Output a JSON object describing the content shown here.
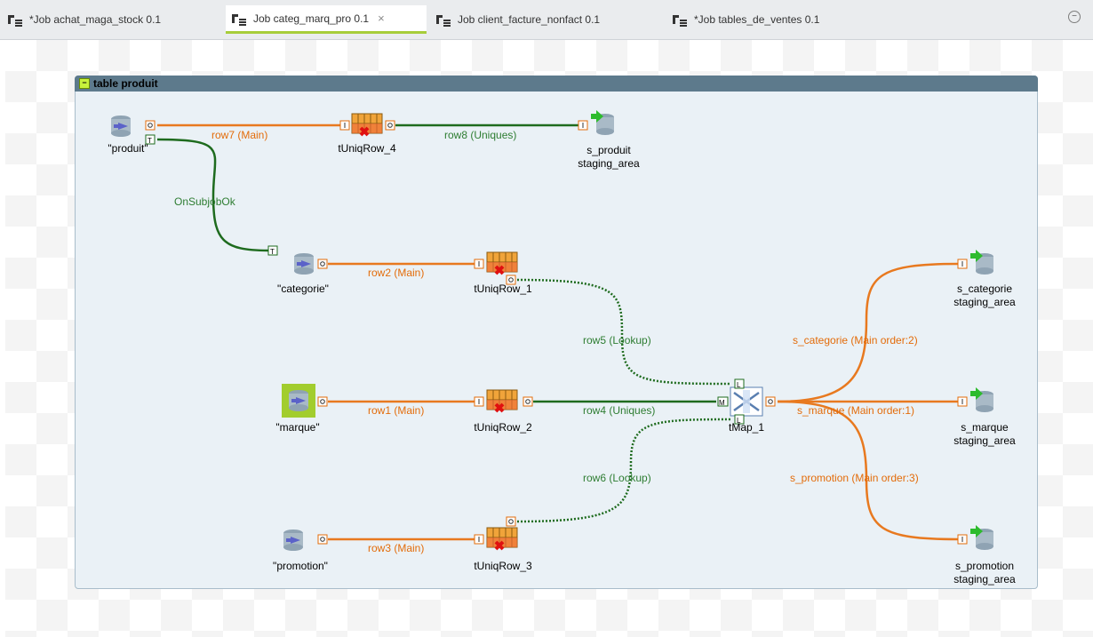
{
  "tabs": [
    {
      "label": "*Job achat_maga_stock 0.1",
      "active": false
    },
    {
      "label": "Job categ_marq_pro 0.1",
      "active": true
    },
    {
      "label": "Job client_facture_nonfact 0.1",
      "active": false
    },
    {
      "label": "*Job tables_de_ventes 0.1",
      "active": false
    }
  ],
  "tab_close_glyph": "×",
  "subjob": {
    "title": "table produit",
    "toggle_glyph": "−"
  },
  "components": {
    "produit": "\"produit\"",
    "categorie": "\"categorie\"",
    "marque": "\"marque\"",
    "promotion": "\"promotion\"",
    "uniq4": "tUniqRow_4",
    "uniq1": "tUniqRow_1",
    "uniq2": "tUniqRow_2",
    "uniq3": "tUniqRow_3",
    "tmap": "tMap_1",
    "s_produit": [
      "s_produit",
      "staging_area"
    ],
    "s_categorie": [
      "s_categorie",
      "staging_area"
    ],
    "s_marque": [
      "s_marque",
      "staging_area"
    ],
    "s_promotion": [
      "s_promotion",
      "staging_area"
    ]
  },
  "links": {
    "row7": "row7 (Main)",
    "row8": "row8 (Uniques)",
    "onsubjob": "OnSubjobOk",
    "row2": "row2 (Main)",
    "row5": "row5 (Lookup)",
    "row1": "row1 (Main)",
    "row4": "row4 (Uniques)",
    "row6": "row6 (Lookup)",
    "row3": "row3 (Main)",
    "s_categorie": "s_categorie (Main order:2)",
    "s_marque": "s_marque (Main order:1)",
    "s_promotion": "s_promotion (Main order:3)"
  },
  "colors": {
    "main_link": "#e8791f",
    "trigger_link": "#1e6b1e",
    "uniques_link": "#1e6b1e",
    "accent_tab": "#a7cd3a"
  },
  "icons": {
    "tab": "job-tab-icon",
    "db_input": "database-input-icon",
    "uniq": "tuniqrow-icon",
    "tmap": "tmap-icon",
    "db_output": "database-output-icon"
  }
}
